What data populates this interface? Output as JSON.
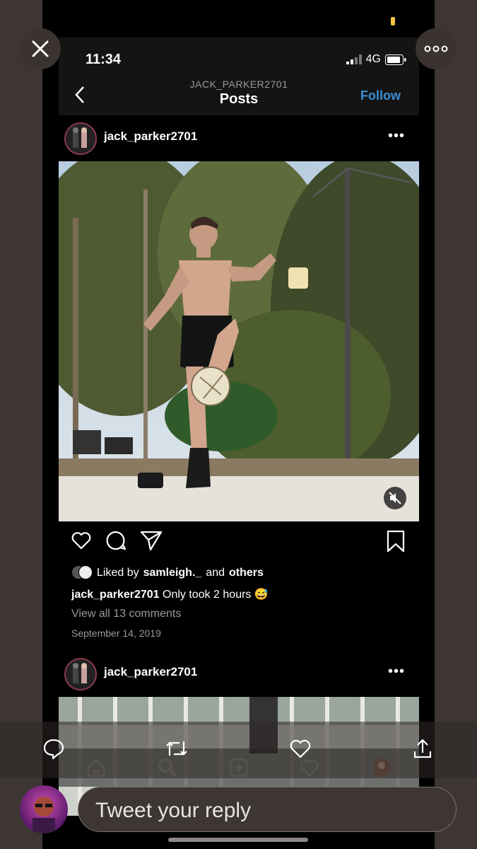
{
  "status_bar": {
    "time": "11:34",
    "network": "4G"
  },
  "nav": {
    "subtitle": "JACK_PARKER2701",
    "title": "Posts",
    "follow_label": "Follow"
  },
  "post": {
    "username": "jack_parker2701",
    "liked_prefix": "Liked by",
    "liked_user": "samleigh._",
    "liked_mid": "and",
    "liked_suffix": "others",
    "caption_user": "jack_parker2701",
    "caption_text": "Only took 2 hours 😅",
    "view_comments": "View all 13 comments",
    "date": "September 14, 2019"
  },
  "post2": {
    "username": "jack_parker2701"
  },
  "reply": {
    "placeholder": "Tweet your reply"
  },
  "colors": {
    "accent": "#3a8fd6",
    "frame": "#3d3633",
    "background": "#000000"
  },
  "icons": [
    "close-icon",
    "more-icon",
    "back-icon",
    "heart-icon",
    "comment-icon",
    "share-icon",
    "bookmark-icon",
    "mute-icon",
    "home-icon",
    "search-icon",
    "add-icon",
    "activity-icon",
    "reply-icon",
    "retweet-icon",
    "like-icon",
    "upload-icon"
  ]
}
